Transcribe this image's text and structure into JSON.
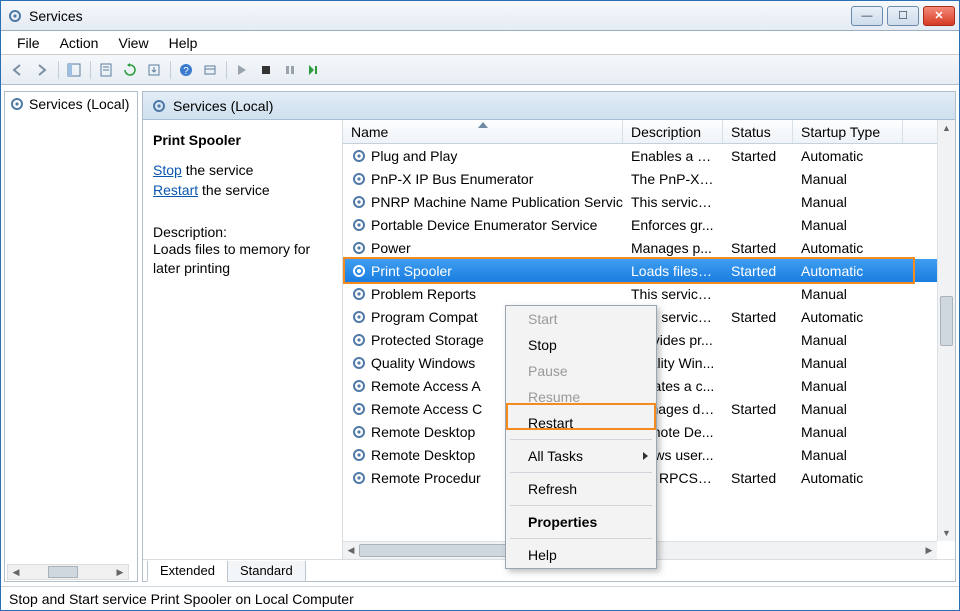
{
  "window": {
    "title": "Services"
  },
  "menus": {
    "file": "File",
    "action": "Action",
    "view": "View",
    "help": "Help"
  },
  "nav": {
    "root": "Services (Local)"
  },
  "mainheader": "Services (Local)",
  "detail": {
    "selected_name": "Print Spooler",
    "stop_link": "Stop",
    "stop_rest": " the service",
    "restart_link": "Restart",
    "restart_rest": " the service",
    "desc_label": "Description:",
    "desc_text": "Loads files to memory for later printing"
  },
  "columns": {
    "name": "Name",
    "description": "Description",
    "status": "Status",
    "startup": "Startup Type"
  },
  "services": [
    {
      "name": "Plug and Play",
      "desc": "Enables a c...",
      "status": "Started",
      "startup": "Automatic"
    },
    {
      "name": "PnP-X IP Bus Enumerator",
      "desc": "The PnP-X b...",
      "status": "",
      "startup": "Manual"
    },
    {
      "name": "PNRP Machine Name Publication Service",
      "desc": "This service ...",
      "status": "",
      "startup": "Manual"
    },
    {
      "name": "Portable Device Enumerator Service",
      "desc": "Enforces gr...",
      "status": "",
      "startup": "Manual"
    },
    {
      "name": "Power",
      "desc": "Manages p...",
      "status": "Started",
      "startup": "Automatic"
    },
    {
      "name": "Print Spooler",
      "desc": "Loads files t...",
      "status": "Started",
      "startup": "Automatic"
    },
    {
      "name": "Problem Reports",
      "desc": "This service ...",
      "status": "",
      "startup": "Manual"
    },
    {
      "name": "Program Compat",
      "desc": "This service ...",
      "status": "Started",
      "startup": "Automatic"
    },
    {
      "name": "Protected Storage",
      "desc": "Provides pr...",
      "status": "",
      "startup": "Manual"
    },
    {
      "name": "Quality Windows",
      "desc": "Quality Win...",
      "status": "",
      "startup": "Manual"
    },
    {
      "name": "Remote Access A",
      "desc": "Creates a c...",
      "status": "",
      "startup": "Manual"
    },
    {
      "name": "Remote Access C",
      "desc": "Manages di...",
      "status": "Started",
      "startup": "Manual"
    },
    {
      "name": "Remote Desktop",
      "desc": "Remote De...",
      "status": "",
      "startup": "Manual"
    },
    {
      "name": "Remote Desktop",
      "desc": "Allows user...",
      "status": "",
      "startup": "Manual"
    },
    {
      "name": "Remote Procedur",
      "desc": "The RPCSS s...",
      "status": "Started",
      "startup": "Automatic"
    }
  ],
  "tabs": {
    "extended": "Extended",
    "standard": "Standard"
  },
  "statusbar": "Stop and Start service Print Spooler on Local Computer",
  "context": {
    "start": "Start",
    "stop": "Stop",
    "pause": "Pause",
    "resume": "Resume",
    "restart": "Restart",
    "alltasks": "All Tasks",
    "refresh": "Refresh",
    "properties": "Properties",
    "help": "Help"
  }
}
